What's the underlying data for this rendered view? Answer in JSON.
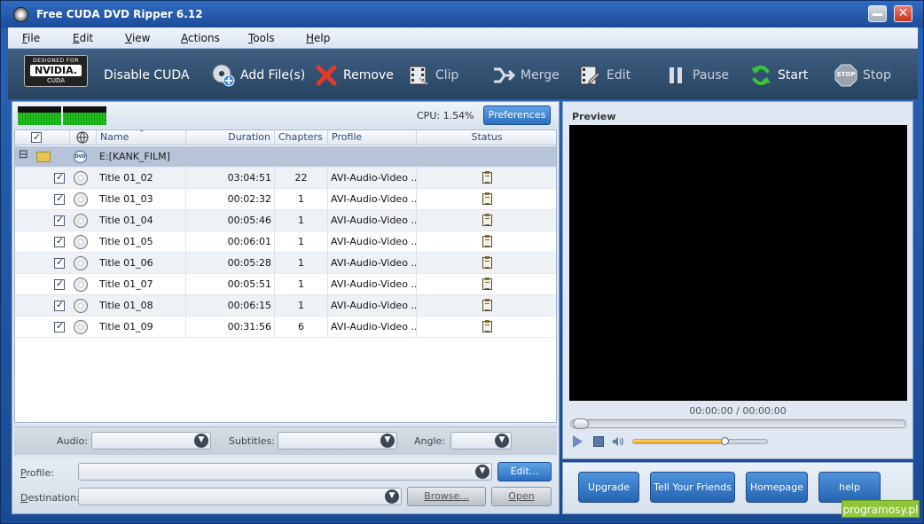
{
  "window": {
    "title": "Free CUDA DVD Ripper 6.12",
    "close_glyph": "✕"
  },
  "menu": [
    {
      "label": "File",
      "mnemonic": "F",
      "rest": "ile"
    },
    {
      "label": "Edit",
      "mnemonic": "E",
      "rest": "dit"
    },
    {
      "label": "View",
      "mnemonic": "V",
      "rest": "iew"
    },
    {
      "label": "Actions",
      "mnemonic": "A",
      "rest": "ctions"
    },
    {
      "label": "Tools",
      "mnemonic": "T",
      "rest": "ools"
    },
    {
      "label": "Help",
      "mnemonic": "H",
      "rest": "elp"
    }
  ],
  "toolbar": {
    "logo": {
      "small": "DESIGNED FOR",
      "main": "NVIDIA.",
      "cuda": "CUDA"
    },
    "disable_cuda": "Disable CUDA",
    "add_files": "Add File(s)",
    "remove": "Remove",
    "clip": "Clip",
    "merge": "Merge",
    "edit": "Edit",
    "pause": "Pause",
    "start": "Start",
    "stop": "Stop",
    "stop_badge": "STOP"
  },
  "cpu": {
    "label": "CPU: 1.54%",
    "preferences": "Preferences"
  },
  "table": {
    "headers": {
      "name": "Name",
      "duration": "Duration",
      "chapters": "Chapters",
      "profile": "Profile",
      "status": "Status",
      "sort_glyph": "ˆ"
    },
    "group": {
      "label": "E:[KANK_FILM]",
      "expander": "⊟",
      "badge": "DVD"
    },
    "rows": [
      {
        "name": "Title 01_02",
        "duration": "03:04:51",
        "chapters": "22",
        "profile": "AVI-Audio-Video ..."
      },
      {
        "name": "Title 01_03",
        "duration": "00:02:32",
        "chapters": "1",
        "profile": "AVI-Audio-Video ..."
      },
      {
        "name": "Title 01_04",
        "duration": "00:05:46",
        "chapters": "1",
        "profile": "AVI-Audio-Video ..."
      },
      {
        "name": "Title 01_05",
        "duration": "00:06:01",
        "chapters": "1",
        "profile": "AVI-Audio-Video ..."
      },
      {
        "name": "Title 01_06",
        "duration": "00:05:28",
        "chapters": "1",
        "profile": "AVI-Audio-Video ..."
      },
      {
        "name": "Title 01_07",
        "duration": "00:05:51",
        "chapters": "1",
        "profile": "AVI-Audio-Video ..."
      },
      {
        "name": "Title 01_08",
        "duration": "00:06:15",
        "chapters": "1",
        "profile": "AVI-Audio-Video ..."
      },
      {
        "name": "Title 01_09",
        "duration": "00:31:56",
        "chapters": "6",
        "profile": "AVI-Audio-Video ..."
      }
    ]
  },
  "tracks": {
    "audio_label": "Audio:",
    "subtitles_label": "Subtitles:",
    "angle_label": "Angle:",
    "drop_glyph": "▼"
  },
  "output": {
    "profile_label": "Profile:",
    "profile_mnemonic": "P",
    "profile_rest": "rofile:",
    "destination_label": "Destination:",
    "destination_mnemonic": "D",
    "destination_rest": "estination:",
    "edit_button": "Edit...",
    "browse_button": "Browse...",
    "open_button": "Open"
  },
  "preview": {
    "title": "Preview",
    "time": "00:00:00 / 00:00:00",
    "volume_level": 0.68
  },
  "links": {
    "upgrade": "Upgrade",
    "tell_friends": "Tell Your Friends",
    "homepage": "Homepage",
    "help": "help"
  },
  "watermark": "programosy.pl"
}
